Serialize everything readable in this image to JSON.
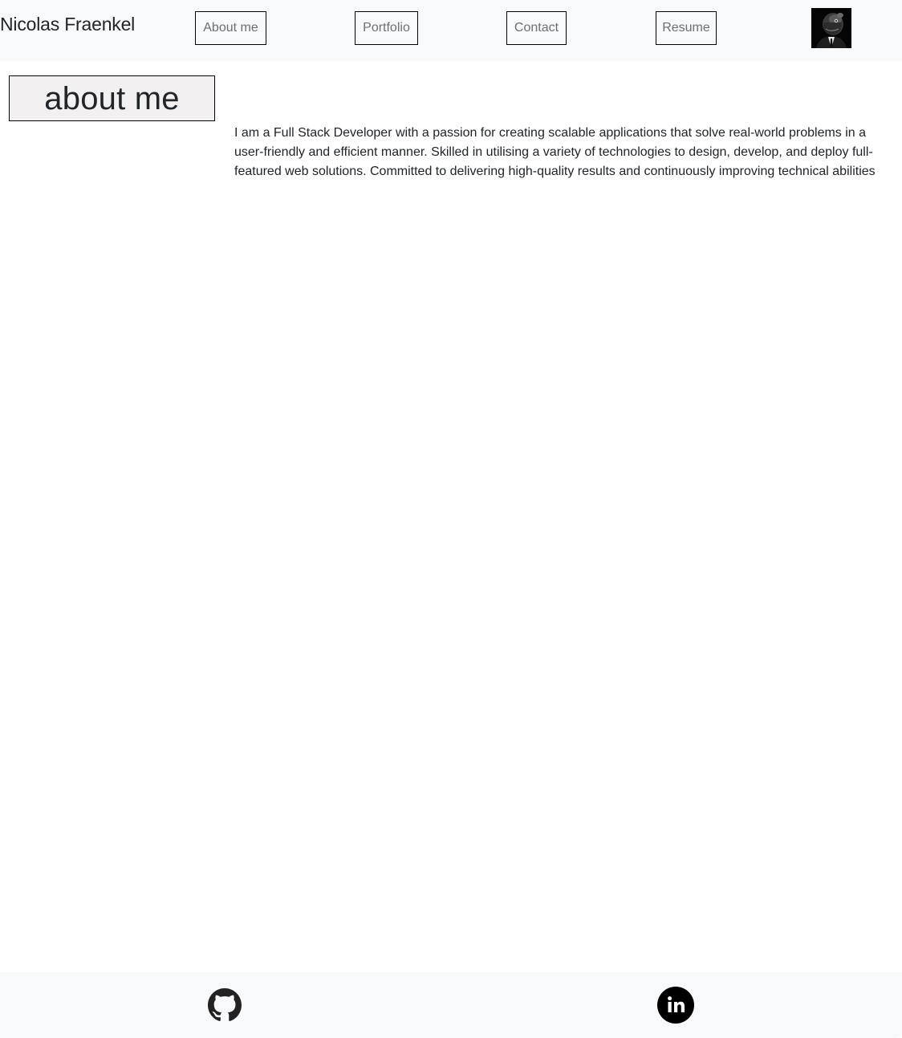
{
  "header": {
    "brand": "Nicolas Fraenkel",
    "nav": [
      {
        "label": "About me"
      },
      {
        "label": "Portfolio"
      },
      {
        "label": "Contact"
      },
      {
        "label": "Resume"
      }
    ],
    "avatar_icon": "profile-photo"
  },
  "main": {
    "heading": "about me",
    "paragraph": "I am a Full Stack Developer with a passion for creating scalable applications that solve real-world problems in a user-friendly and efficient manner. Skilled in utilising a variety of technologies to design, develop, and deploy full-featured web solutions. Committed to delivering high-quality results and continuously improving technical abilities"
  },
  "footer": {
    "links": [
      {
        "icon": "github-icon"
      },
      {
        "icon": "linkedin-icon"
      }
    ]
  },
  "colors": {
    "navbar_bg": "#f8f9fa",
    "heading_bg": "#f2f0f0",
    "text": "#212529",
    "nav_text": "#6c6f73"
  }
}
